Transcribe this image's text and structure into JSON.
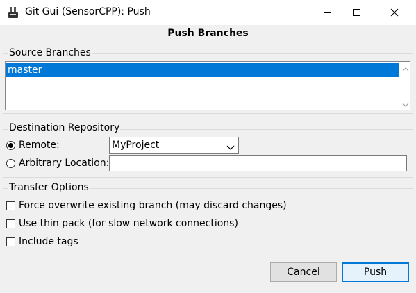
{
  "window": {
    "title": "Git Gui (SensorCPP): Push"
  },
  "heading": "Push Branches",
  "source_branches": {
    "label": "Source Branches",
    "items": [
      "master"
    ],
    "selected": "master"
  },
  "destination": {
    "label": "Destination Repository",
    "remote_label": "Remote:",
    "remote_value": "MyProject",
    "remote_checked": true,
    "arbitrary_label": "Arbitrary Location:",
    "arbitrary_value": ""
  },
  "transfer": {
    "label": "Transfer Options",
    "options": [
      {
        "label": "Force overwrite existing branch (may discard changes)",
        "checked": false
      },
      {
        "label": "Use thin pack (for slow network connections)",
        "checked": false
      },
      {
        "label": "Include tags",
        "checked": false
      }
    ]
  },
  "buttons": {
    "cancel": "Cancel",
    "push": "Push"
  },
  "colors": {
    "selection": "#0078d7",
    "default_button_border": "#0078d7"
  },
  "icons": {
    "app": "git-gui-icon",
    "minimize": "minimize-icon",
    "maximize": "maximize-icon",
    "close": "close-icon",
    "dropdown": "chevron-down-icon"
  }
}
